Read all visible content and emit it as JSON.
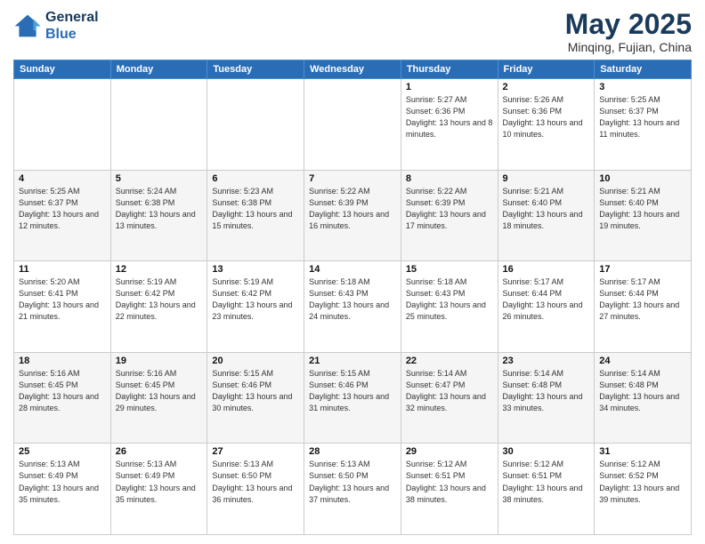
{
  "logo": {
    "line1": "General",
    "line2": "Blue"
  },
  "title": "May 2025",
  "location": "Minqing, Fujian, China",
  "days_of_week": [
    "Sunday",
    "Monday",
    "Tuesday",
    "Wednesday",
    "Thursday",
    "Friday",
    "Saturday"
  ],
  "weeks": [
    [
      {
        "day": "",
        "info": ""
      },
      {
        "day": "",
        "info": ""
      },
      {
        "day": "",
        "info": ""
      },
      {
        "day": "",
        "info": ""
      },
      {
        "day": "1",
        "info": "Sunrise: 5:27 AM\nSunset: 6:36 PM\nDaylight: 13 hours\nand 8 minutes."
      },
      {
        "day": "2",
        "info": "Sunrise: 5:26 AM\nSunset: 6:36 PM\nDaylight: 13 hours\nand 10 minutes."
      },
      {
        "day": "3",
        "info": "Sunrise: 5:25 AM\nSunset: 6:37 PM\nDaylight: 13 hours\nand 11 minutes."
      }
    ],
    [
      {
        "day": "4",
        "info": "Sunrise: 5:25 AM\nSunset: 6:37 PM\nDaylight: 13 hours\nand 12 minutes."
      },
      {
        "day": "5",
        "info": "Sunrise: 5:24 AM\nSunset: 6:38 PM\nDaylight: 13 hours\nand 13 minutes."
      },
      {
        "day": "6",
        "info": "Sunrise: 5:23 AM\nSunset: 6:38 PM\nDaylight: 13 hours\nand 15 minutes."
      },
      {
        "day": "7",
        "info": "Sunrise: 5:22 AM\nSunset: 6:39 PM\nDaylight: 13 hours\nand 16 minutes."
      },
      {
        "day": "8",
        "info": "Sunrise: 5:22 AM\nSunset: 6:39 PM\nDaylight: 13 hours\nand 17 minutes."
      },
      {
        "day": "9",
        "info": "Sunrise: 5:21 AM\nSunset: 6:40 PM\nDaylight: 13 hours\nand 18 minutes."
      },
      {
        "day": "10",
        "info": "Sunrise: 5:21 AM\nSunset: 6:40 PM\nDaylight: 13 hours\nand 19 minutes."
      }
    ],
    [
      {
        "day": "11",
        "info": "Sunrise: 5:20 AM\nSunset: 6:41 PM\nDaylight: 13 hours\nand 21 minutes."
      },
      {
        "day": "12",
        "info": "Sunrise: 5:19 AM\nSunset: 6:42 PM\nDaylight: 13 hours\nand 22 minutes."
      },
      {
        "day": "13",
        "info": "Sunrise: 5:19 AM\nSunset: 6:42 PM\nDaylight: 13 hours\nand 23 minutes."
      },
      {
        "day": "14",
        "info": "Sunrise: 5:18 AM\nSunset: 6:43 PM\nDaylight: 13 hours\nand 24 minutes."
      },
      {
        "day": "15",
        "info": "Sunrise: 5:18 AM\nSunset: 6:43 PM\nDaylight: 13 hours\nand 25 minutes."
      },
      {
        "day": "16",
        "info": "Sunrise: 5:17 AM\nSunset: 6:44 PM\nDaylight: 13 hours\nand 26 minutes."
      },
      {
        "day": "17",
        "info": "Sunrise: 5:17 AM\nSunset: 6:44 PM\nDaylight: 13 hours\nand 27 minutes."
      }
    ],
    [
      {
        "day": "18",
        "info": "Sunrise: 5:16 AM\nSunset: 6:45 PM\nDaylight: 13 hours\nand 28 minutes."
      },
      {
        "day": "19",
        "info": "Sunrise: 5:16 AM\nSunset: 6:45 PM\nDaylight: 13 hours\nand 29 minutes."
      },
      {
        "day": "20",
        "info": "Sunrise: 5:15 AM\nSunset: 6:46 PM\nDaylight: 13 hours\nand 30 minutes."
      },
      {
        "day": "21",
        "info": "Sunrise: 5:15 AM\nSunset: 6:46 PM\nDaylight: 13 hours\nand 31 minutes."
      },
      {
        "day": "22",
        "info": "Sunrise: 5:14 AM\nSunset: 6:47 PM\nDaylight: 13 hours\nand 32 minutes."
      },
      {
        "day": "23",
        "info": "Sunrise: 5:14 AM\nSunset: 6:48 PM\nDaylight: 13 hours\nand 33 minutes."
      },
      {
        "day": "24",
        "info": "Sunrise: 5:14 AM\nSunset: 6:48 PM\nDaylight: 13 hours\nand 34 minutes."
      }
    ],
    [
      {
        "day": "25",
        "info": "Sunrise: 5:13 AM\nSunset: 6:49 PM\nDaylight: 13 hours\nand 35 minutes."
      },
      {
        "day": "26",
        "info": "Sunrise: 5:13 AM\nSunset: 6:49 PM\nDaylight: 13 hours\nand 35 minutes."
      },
      {
        "day": "27",
        "info": "Sunrise: 5:13 AM\nSunset: 6:50 PM\nDaylight: 13 hours\nand 36 minutes."
      },
      {
        "day": "28",
        "info": "Sunrise: 5:13 AM\nSunset: 6:50 PM\nDaylight: 13 hours\nand 37 minutes."
      },
      {
        "day": "29",
        "info": "Sunrise: 5:12 AM\nSunset: 6:51 PM\nDaylight: 13 hours\nand 38 minutes."
      },
      {
        "day": "30",
        "info": "Sunrise: 5:12 AM\nSunset: 6:51 PM\nDaylight: 13 hours\nand 38 minutes."
      },
      {
        "day": "31",
        "info": "Sunrise: 5:12 AM\nSunset: 6:52 PM\nDaylight: 13 hours\nand 39 minutes."
      }
    ]
  ]
}
